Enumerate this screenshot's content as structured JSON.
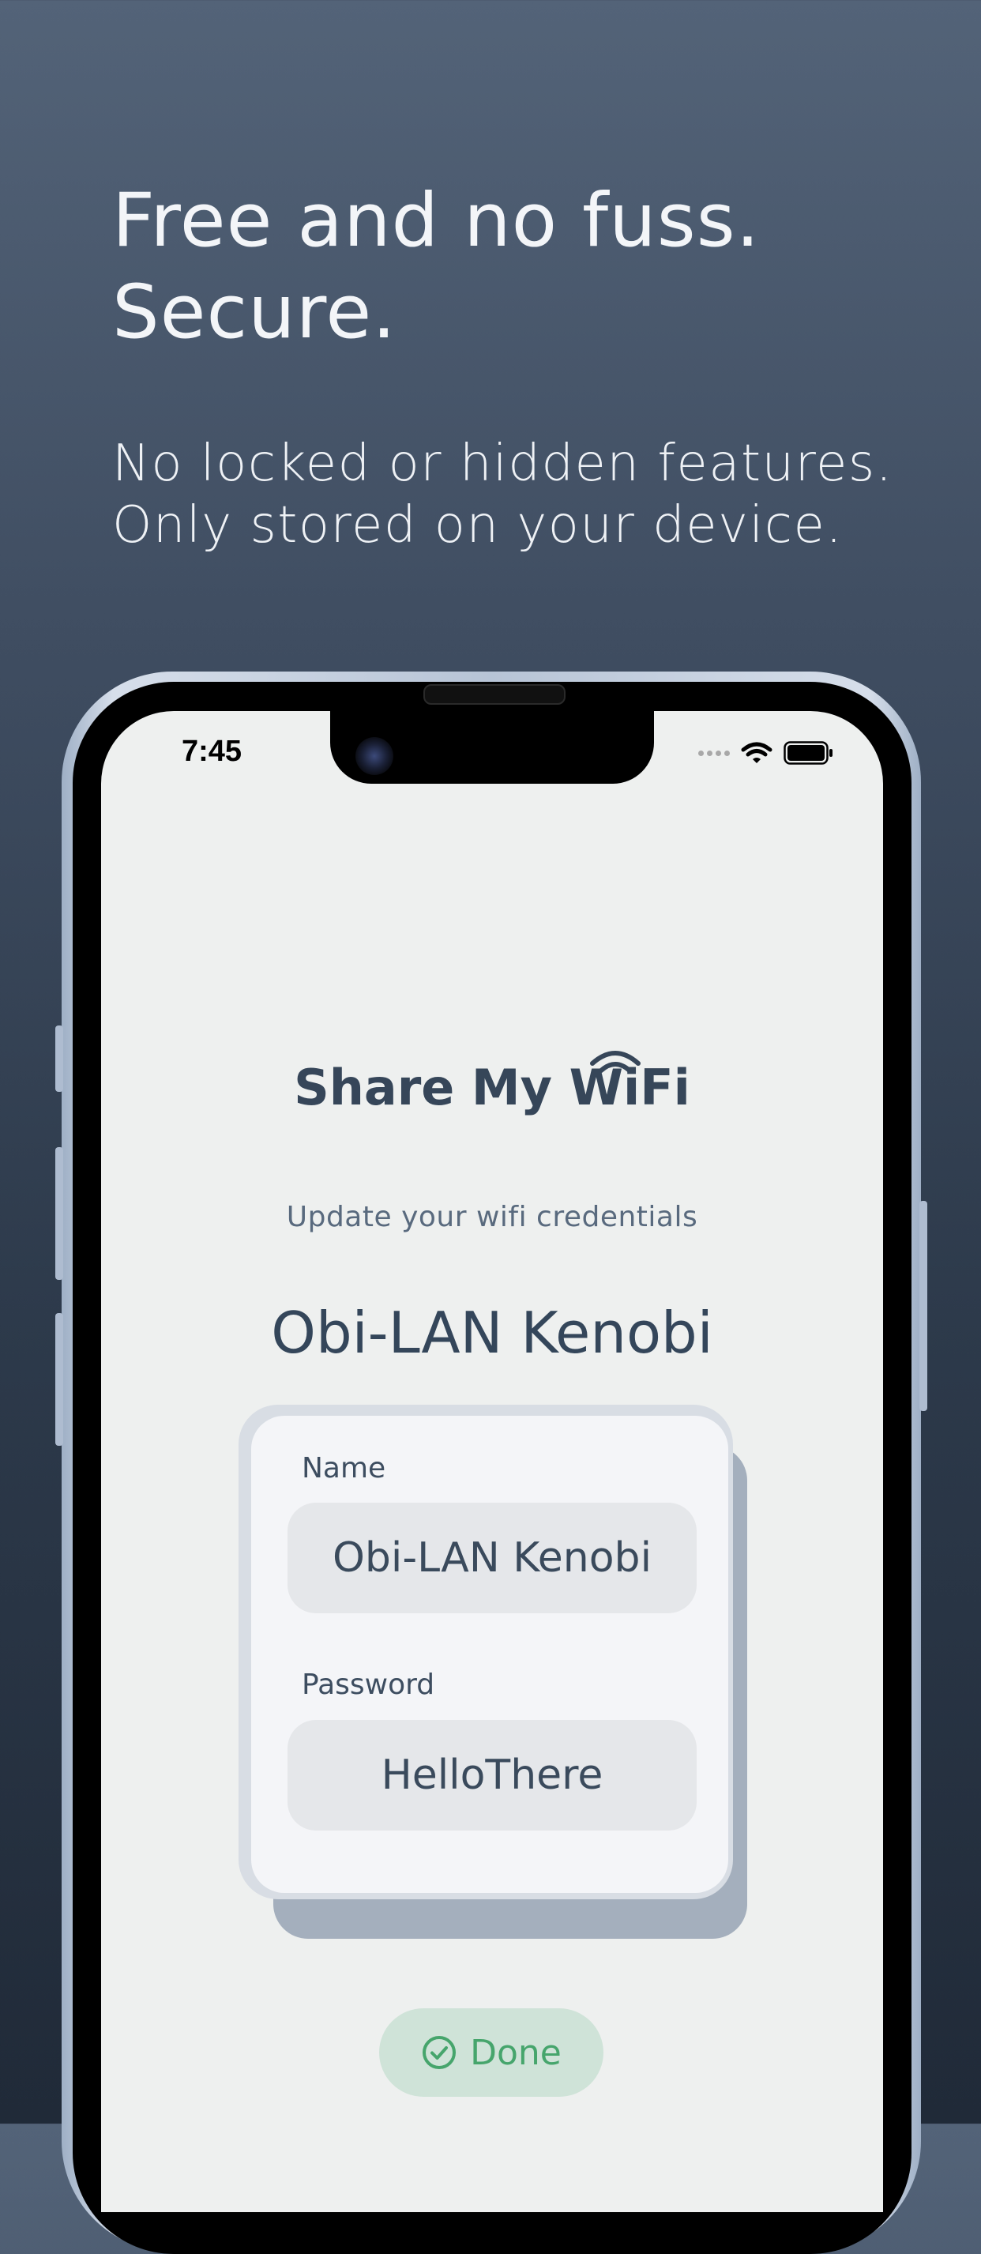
{
  "promo": {
    "headline_line1": "Free and no fuss.",
    "headline_line2": "Secure.",
    "subline_line1": "No locked or hidden features.",
    "subline_line2": "Only stored on your device."
  },
  "status_bar": {
    "time": "7:45"
  },
  "app": {
    "title": "Share My WiFi",
    "subtitle": "Update your wifi credentials",
    "network_name": "Obi-LAN Kenobi",
    "form": {
      "name_label": "Name",
      "name_value": "Obi-LAN Kenobi",
      "password_label": "Password",
      "password_value": "HelloThere"
    },
    "done_label": "Done"
  },
  "colors": {
    "title_text": "#364659",
    "done_green": "#46a56c",
    "done_bg": "#cfe3d8"
  },
  "icons": [
    "wifi-icon",
    "battery-icon",
    "signal-dots-icon",
    "check-circle-icon",
    "front-camera"
  ]
}
